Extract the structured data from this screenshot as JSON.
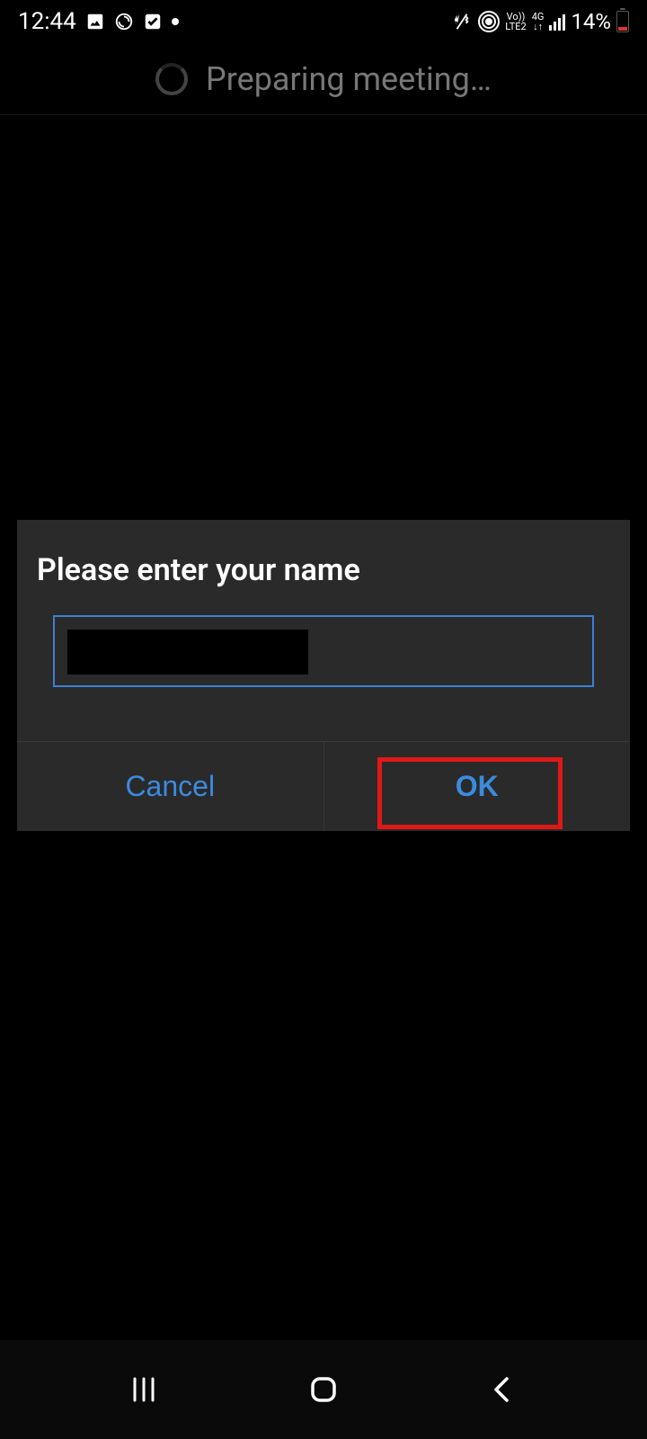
{
  "status_bar": {
    "time": "12:44",
    "battery_percent": "14%",
    "network_label_top": "Vo))",
    "network_label_bottom": "LTE2",
    "data_label": "4G"
  },
  "header": {
    "loading_text": "Preparing meeting…"
  },
  "dialog": {
    "title": "Please enter your name",
    "input_value": "",
    "cancel_label": "Cancel",
    "ok_label": "OK"
  },
  "highlight": {
    "target": "ok-button"
  }
}
